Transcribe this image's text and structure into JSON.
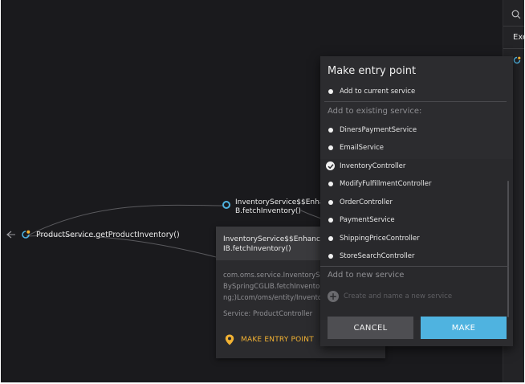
{
  "graph": {
    "main_node_label": "ProductService.getProductInventory()",
    "inventory_node_label": "InventoryService$$Enhan\nB.fetchInventory()"
  },
  "popup": {
    "header_text": "InventoryService$$Enhancer\nIB.fetchInventory()",
    "description": "com.oms.service.InventorySe\nBySpringCGLIB.fetchInvento\nng;)Lcom/oms/entity/Invento",
    "service": "Service: ProductController",
    "make_entry_point_label": "MAKE ENTRY POINT"
  },
  "right_panel": {
    "partial_text": "Exe"
  },
  "dialog": {
    "title": "Make entry point",
    "add_to_current": "Add to current service",
    "existing_header": "Add to existing service:",
    "services": [
      {
        "name": "DinersPaymentService",
        "selected": false
      },
      {
        "name": "EmailService",
        "selected": false
      },
      {
        "name": "InventoryController",
        "selected": true
      },
      {
        "name": "ModifyFulfillmentController",
        "selected": false
      },
      {
        "name": "OrderController",
        "selected": false
      },
      {
        "name": "PaymentService",
        "selected": false
      },
      {
        "name": "ShippingPriceController",
        "selected": false
      },
      {
        "name": "StoreSearchController",
        "selected": false
      }
    ],
    "new_header": "Add to new service",
    "create_placeholder": "Create and name a new service",
    "cancel_label": "CANCEL",
    "make_label": "MAKE"
  },
  "colors": {
    "canvas": "#1a1a1d",
    "accent_blue": "#4fb3e0",
    "accent_orange": "#f2b233"
  }
}
